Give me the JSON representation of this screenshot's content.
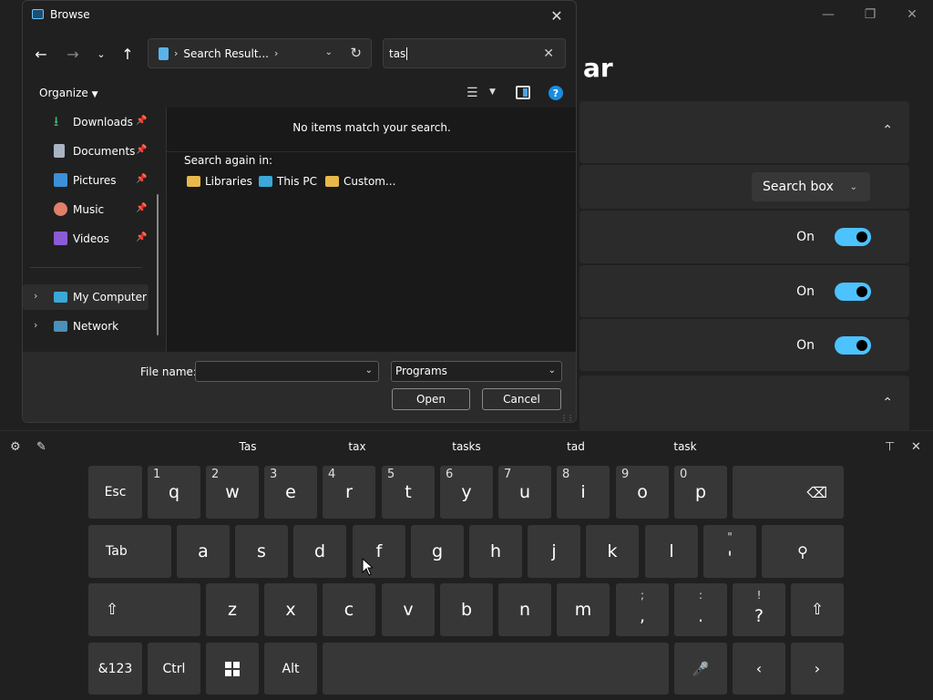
{
  "background_window": {
    "title": "ar",
    "dropdown_value": "Search box",
    "toggle_rows": [
      {
        "state": "On"
      },
      {
        "state": "On"
      },
      {
        "state": "On"
      }
    ]
  },
  "dialog": {
    "title": "Browse",
    "address": {
      "crumb": "Search Result..."
    },
    "search": {
      "value": "tas"
    },
    "toolbar": {
      "organize": "Organize"
    },
    "nav_items": [
      {
        "label": "Downloads",
        "pinned": true
      },
      {
        "label": "Documents",
        "pinned": true
      },
      {
        "label": "Pictures",
        "pinned": true
      },
      {
        "label": "Music",
        "pinned": true
      },
      {
        "label": "Videos",
        "pinned": true
      },
      {
        "label": "My Computer",
        "selected": true
      },
      {
        "label": "Network"
      }
    ],
    "content": {
      "empty_message": "No items match your search.",
      "search_again_label": "Search again in:",
      "locations": [
        "Libraries",
        "This PC",
        "Custom..."
      ]
    },
    "footer": {
      "file_name_label": "File name:",
      "file_name_value": "",
      "file_type": "Programs",
      "open_label": "Open",
      "cancel_label": "Cancel"
    }
  },
  "keyboard": {
    "suggestions": [
      "Tas",
      "tax",
      "tasks",
      "tad",
      "task"
    ],
    "row1": [
      {
        "key": "Esc"
      },
      {
        "key": "q",
        "num": "1"
      },
      {
        "key": "w",
        "num": "2"
      },
      {
        "key": "e",
        "num": "3"
      },
      {
        "key": "r",
        "num": "4"
      },
      {
        "key": "t",
        "num": "5"
      },
      {
        "key": "y",
        "num": "6"
      },
      {
        "key": "u",
        "num": "7"
      },
      {
        "key": "i",
        "num": "8"
      },
      {
        "key": "o",
        "num": "9"
      },
      {
        "key": "p",
        "num": "0"
      }
    ],
    "row2": [
      {
        "key": "Tab"
      },
      {
        "key": "a"
      },
      {
        "key": "s"
      },
      {
        "key": "d"
      },
      {
        "key": "f"
      },
      {
        "key": "g"
      },
      {
        "key": "h"
      },
      {
        "key": "j"
      },
      {
        "key": "k"
      },
      {
        "key": "l"
      },
      {
        "key": "'",
        "upper": "\""
      }
    ],
    "row3": [
      {
        "key": "z"
      },
      {
        "key": "x"
      },
      {
        "key": "c"
      },
      {
        "key": "v"
      },
      {
        "key": "b"
      },
      {
        "key": "n"
      },
      {
        "key": "m"
      },
      {
        "key": ",",
        "upper": ";"
      },
      {
        "key": ".",
        "upper": ":"
      },
      {
        "key": "?",
        "upper": "!"
      }
    ],
    "row4": {
      "symbols": "&123",
      "ctrl": "Ctrl",
      "alt": "Alt"
    }
  }
}
